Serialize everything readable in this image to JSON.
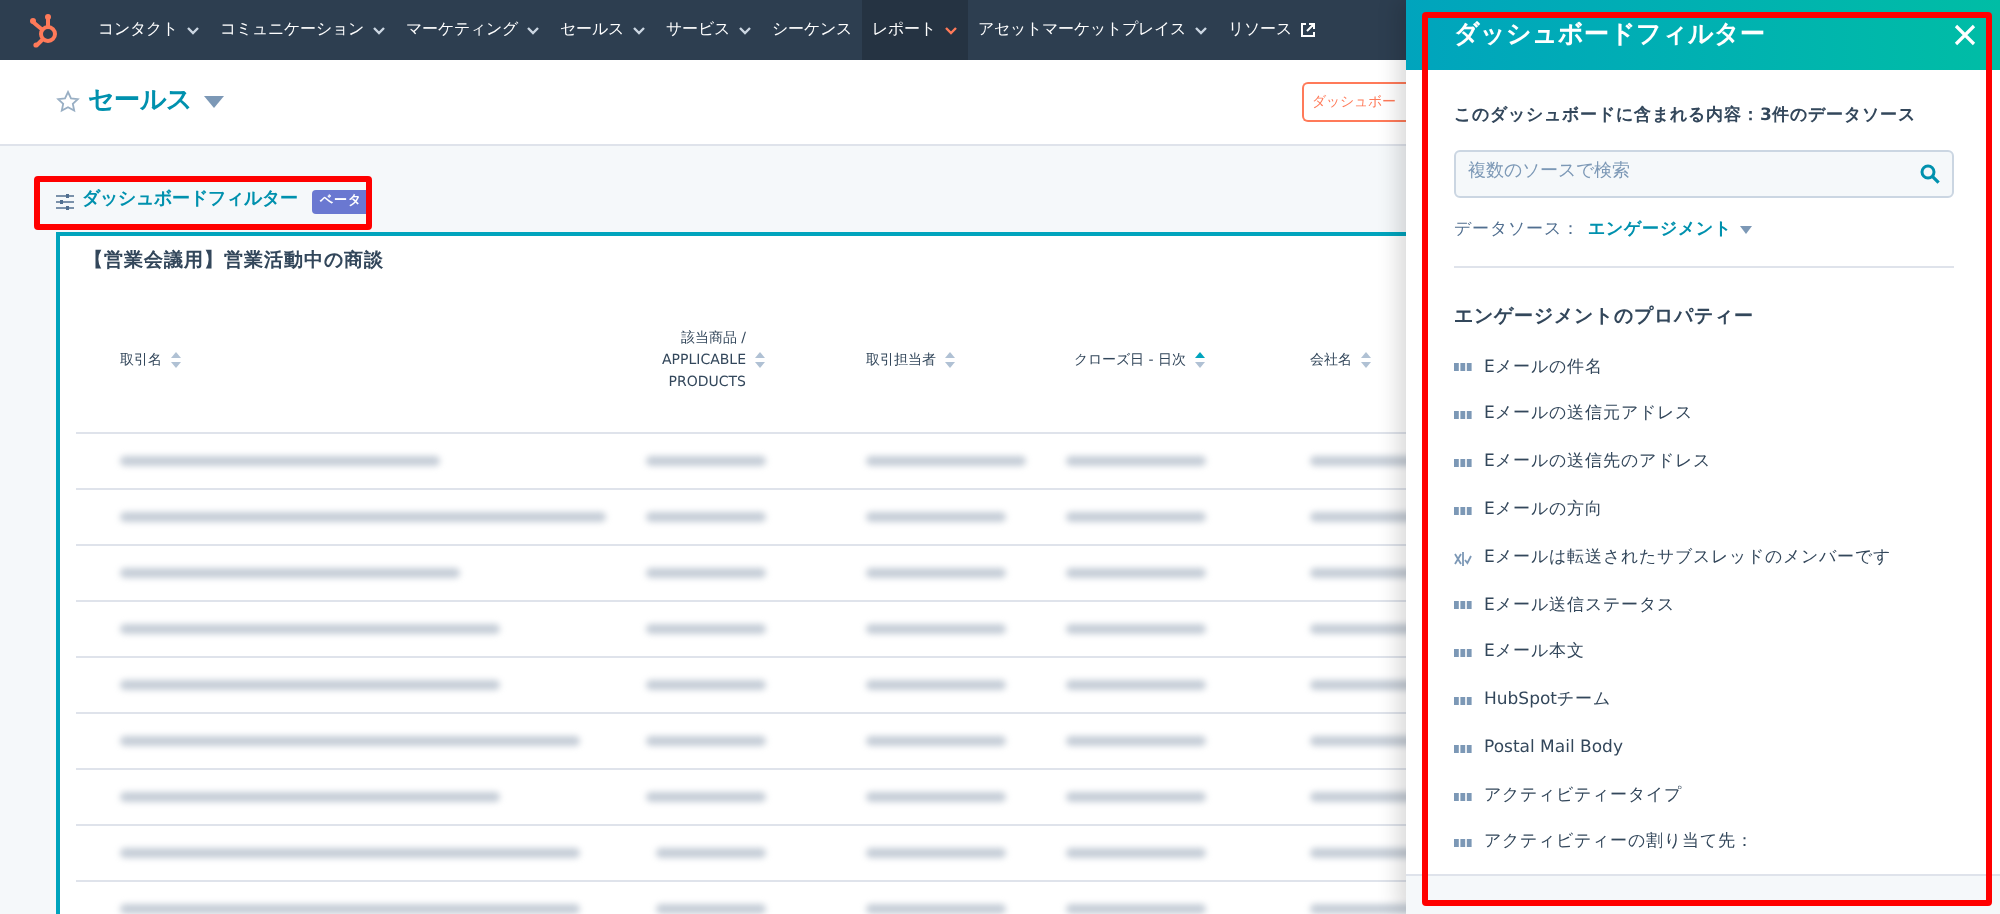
{
  "nav": {
    "items": [
      {
        "label": "コンタクト",
        "caret": true,
        "external": false,
        "selected": false
      },
      {
        "label": "コミュニケーション",
        "caret": true,
        "external": false,
        "selected": false
      },
      {
        "label": "マーケティング",
        "caret": true,
        "external": false,
        "selected": false
      },
      {
        "label": "セールス",
        "caret": true,
        "external": false,
        "selected": false
      },
      {
        "label": "サービス",
        "caret": true,
        "external": false,
        "selected": false
      },
      {
        "label": "シーケンス",
        "caret": false,
        "external": false,
        "selected": false
      },
      {
        "label": "レポート",
        "caret": true,
        "external": false,
        "selected": true
      },
      {
        "label": "アセットマーケットプレイス",
        "caret": true,
        "external": false,
        "selected": false
      },
      {
        "label": "リソース",
        "caret": false,
        "external": true,
        "selected": false
      }
    ]
  },
  "header": {
    "title": "セールス",
    "button": "ダッシュボー"
  },
  "filter_link": {
    "label": "ダッシュボードフィルター",
    "badge": "ベータ"
  },
  "report": {
    "title": "【営業会議用】営業活動中の商談",
    "columns": [
      {
        "label": "取引名",
        "sorted": false
      },
      {
        "label": "該当商品 / APPLICABLE PRODUCTS",
        "sorted": false
      },
      {
        "label": "取引担当者",
        "sorted": false
      },
      {
        "label": "クローズ日 - 日次",
        "sorted": true
      },
      {
        "label": "会社名",
        "sorted": false
      }
    ]
  },
  "panel": {
    "title": "ダッシュボードフィルター",
    "summary": "このダッシュボードに含まれる内容：3件のデータソース",
    "search": {
      "placeholder": "複数のソースで検索"
    },
    "source_label": "データソース：",
    "source_value": "エンゲージメント",
    "section_title": "エンゲージメントのプロパティー",
    "properties": [
      {
        "label": "Eメールの件名",
        "kind": "text"
      },
      {
        "label": "Eメールの送信元アドレス",
        "kind": "text"
      },
      {
        "label": "Eメールの送信先のアドレス",
        "kind": "text"
      },
      {
        "label": "Eメールの方向",
        "kind": "text"
      },
      {
        "label": "Eメールは転送されたサブスレッドのメンバーです",
        "kind": "boolean"
      },
      {
        "label": "Eメール送信ステータス",
        "kind": "text"
      },
      {
        "label": "Eメール本文",
        "kind": "text"
      },
      {
        "label": "HubSpotチーム",
        "kind": "text"
      },
      {
        "label": "Postal Mail Body",
        "kind": "text"
      },
      {
        "label": "アクティビティータイプ",
        "kind": "text"
      },
      {
        "label": "アクティビティーの割り当て先：",
        "kind": "text"
      }
    ]
  }
}
